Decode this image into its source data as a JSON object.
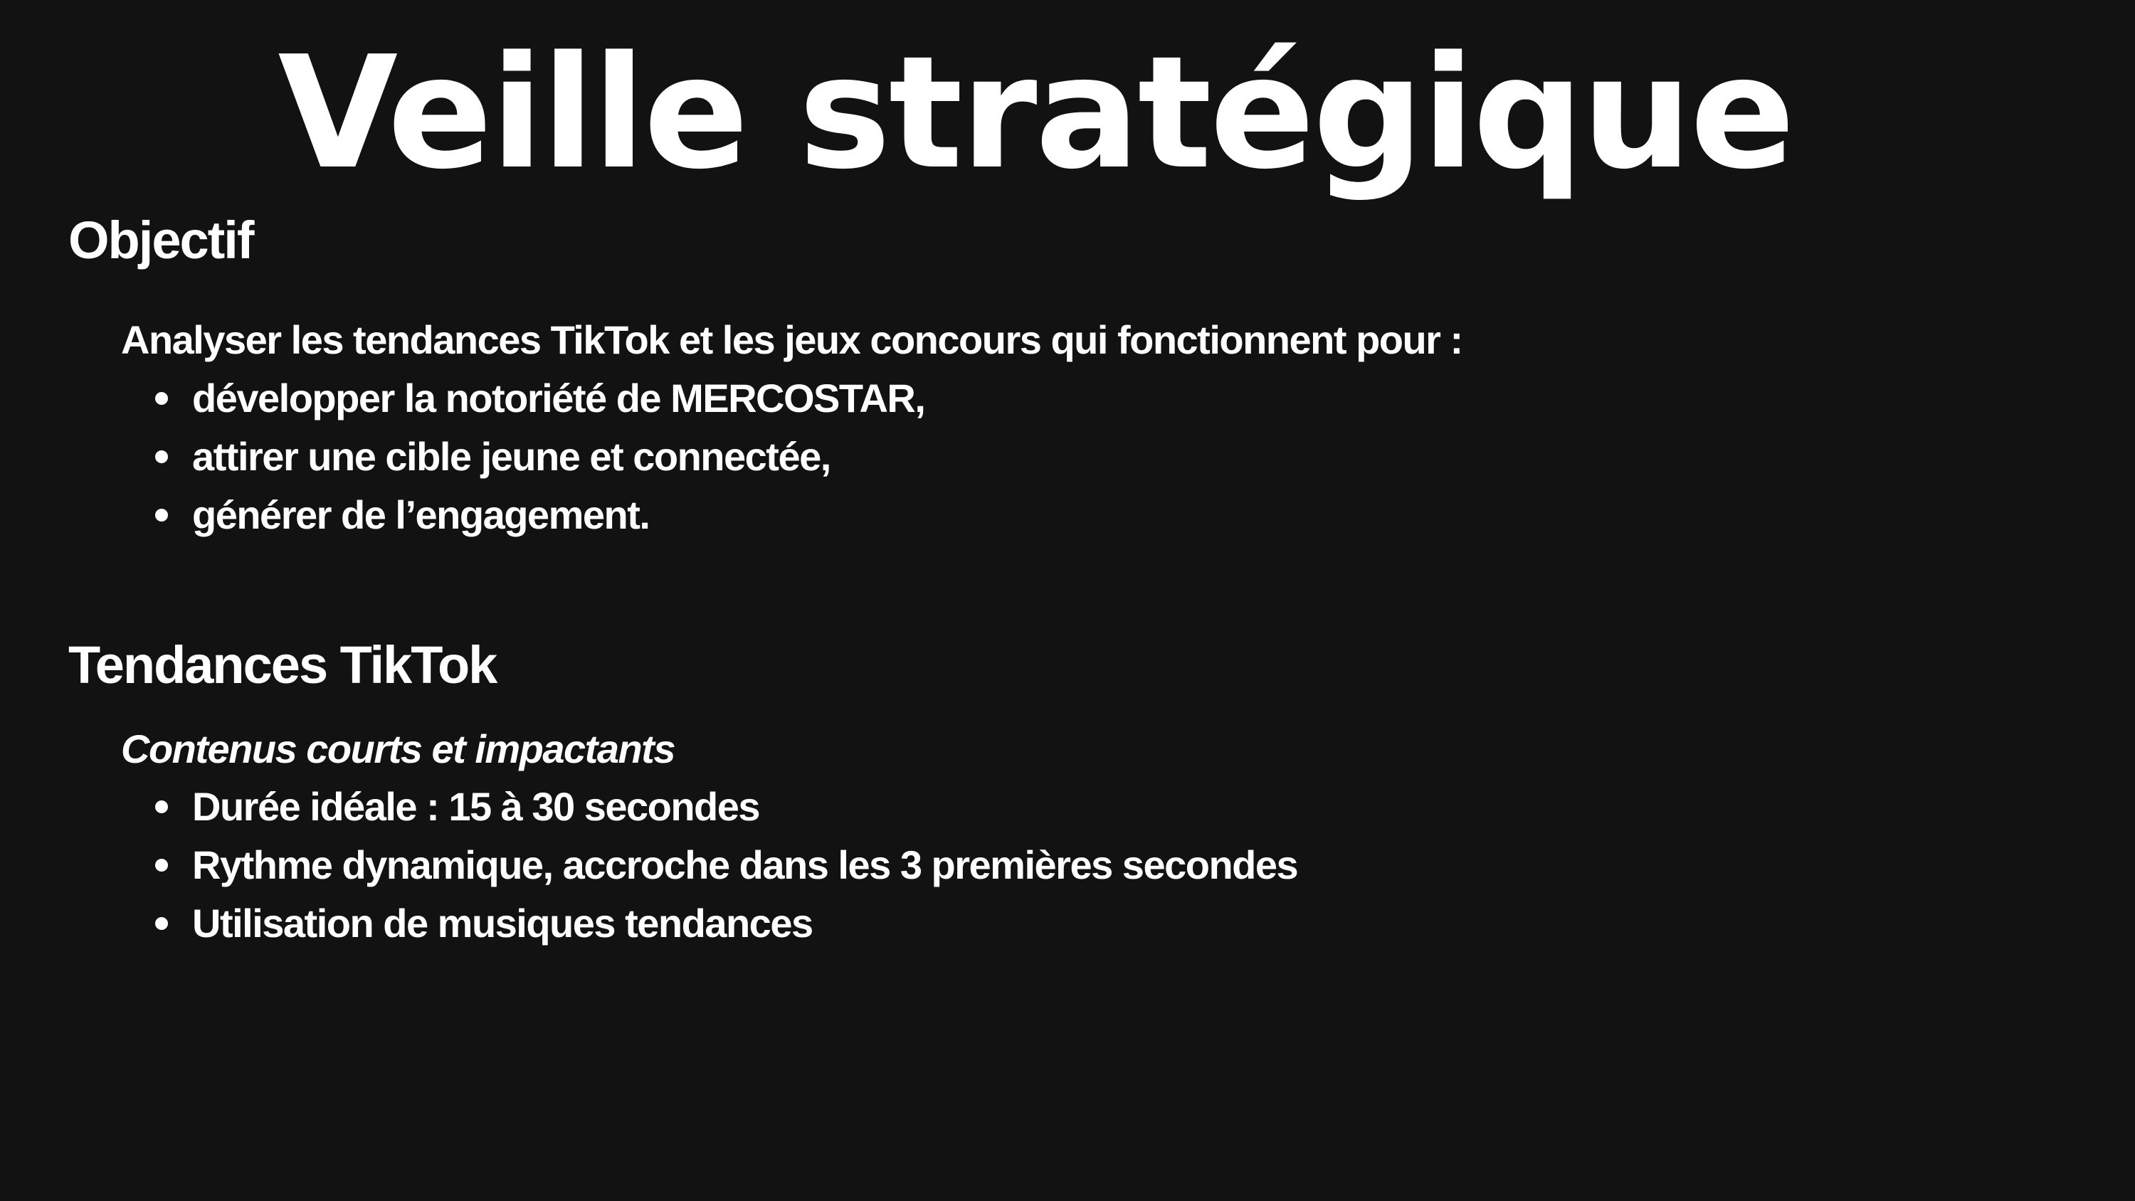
{
  "title": "Veille stratégique",
  "sections": [
    {
      "heading": "Objectif",
      "intro": "Analyser les tendances TikTok et les jeux concours qui fonctionnent pour :",
      "bullets": [
        "développer la notoriété de MERCOSTAR,",
        "attirer une cible jeune et connectée,",
        "générer de l’engagement."
      ]
    },
    {
      "heading": "Tendances TikTok",
      "intro": "Contenus courts et impactants",
      "bullets": [
        "Durée idéale : 15 à 30 secondes",
        "Rythme dynamique, accroche dans les 3 premières secondes",
        "Utilisation de musiques tendances"
      ]
    }
  ],
  "colors": {
    "background": "#121212",
    "text": "#ffffff"
  }
}
